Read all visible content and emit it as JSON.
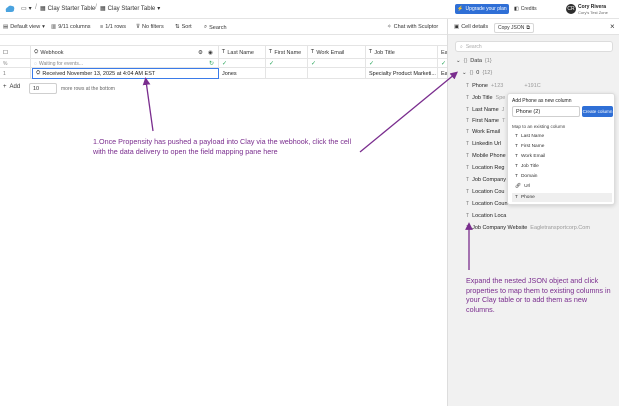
{
  "topbar": {
    "breadcrumb_1": "Clay Starter Table",
    "breadcrumb_2": "Clay Starter Table",
    "upgrade": "Upgrade your plan",
    "credits": "Credits",
    "avatar_initials": "CR",
    "user_name": "Cory Rivera",
    "user_zone": "Cory's Test Zone"
  },
  "toolbar": {
    "default_view": "Default view",
    "columns": "9/11 columns",
    "rows": "1/1 rows",
    "filters": "No filters",
    "sort": "Sort",
    "search": "Search",
    "chat": "Chat with Sculptor"
  },
  "grid": {
    "headers": {
      "webhook": "Webhook",
      "last_name": "Last Name",
      "first_name": "First Name",
      "work_email": "Work Email",
      "job_title": "Job Title",
      "extra": "Ea"
    },
    "status": {
      "rowmark": "%",
      "webhook": "Waiting for events..."
    },
    "row": {
      "num": "1",
      "webhook": "Received November 13, 2025 at 4:04 AM EST",
      "last_name": "Jones",
      "job_title": "Specialty Product Marketi...",
      "extra": "Ea"
    },
    "add_label": "Add",
    "add_count": "10",
    "more_rows": "more rows at the bottom"
  },
  "panel": {
    "title": "Cell details",
    "copy": "Copy JSON",
    "search_placeholder": "Search",
    "data_label": "Data",
    "data_badge": "{1}",
    "index_label": "0",
    "index_badge": "{12}",
    "props": [
      {
        "name": "Phone",
        "value": "+123",
        "value2": "+191C"
      },
      {
        "name": "Job Title",
        "value": "Spe"
      },
      {
        "name": "Last Name",
        "value": "J"
      },
      {
        "name": "First Name",
        "value": "T"
      },
      {
        "name": "Work Email",
        "value": ""
      },
      {
        "name": "Linkedin Url",
        "value": ""
      },
      {
        "name": "Mobile Phone",
        "value": ""
      },
      {
        "name": "Location Reg",
        "value": ""
      },
      {
        "name": "Location Cou",
        "value": ""
      },
      {
        "name": "Location Coun",
        "value": ""
      },
      {
        "name": "Location Loca",
        "value": ""
      },
      {
        "name": "Job Company",
        "value": ""
      },
      {
        "name": "Job Company Website",
        "value": "Eagletransportcorp.Com"
      }
    ]
  },
  "popup": {
    "title": "Add Phone as new column",
    "input_value": "Phone (2)",
    "create": "Create column",
    "subtitle": "Map to an existing column",
    "options": [
      "Last Name",
      "First Name",
      "Work Email",
      "Job Title",
      "Domain",
      "Url",
      "Phone"
    ]
  },
  "annotations": {
    "left": "1.Once Propensity has pushed a payload into Clay via the webhook, click the cell with the data delivery to open the field mapping pane here",
    "right": "Expand the nested JSON object and click properties to map them to existing columns in your Clay table or to add them as new columns."
  },
  "colors": {
    "accent": "#2f6fd6",
    "annotation": "#7a2d8e",
    "check": "#2aa55a"
  }
}
